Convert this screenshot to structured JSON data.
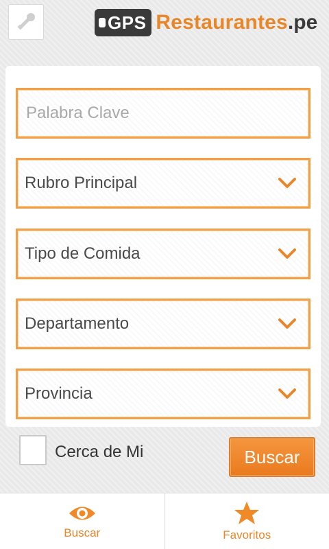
{
  "header": {
    "logo_gps": "GPS",
    "logo_name": "Restaurantes",
    "logo_tld": ".pe"
  },
  "form": {
    "keyword_placeholder": "Palabra Clave",
    "rubro": "Rubro Principal",
    "tipo": "Tipo de Comida",
    "departamento": "Departamento",
    "provincia": "Provincia"
  },
  "footer": {
    "checkbox_label": "Cerca de Mi",
    "search_button": "Buscar"
  },
  "tabs": [
    {
      "label": "Buscar",
      "icon": "eye-icon"
    },
    {
      "label": "Favoritos",
      "icon": "star-icon"
    }
  ],
  "colors": {
    "accent": "#e8862a",
    "field_border": "#f1a04a"
  }
}
